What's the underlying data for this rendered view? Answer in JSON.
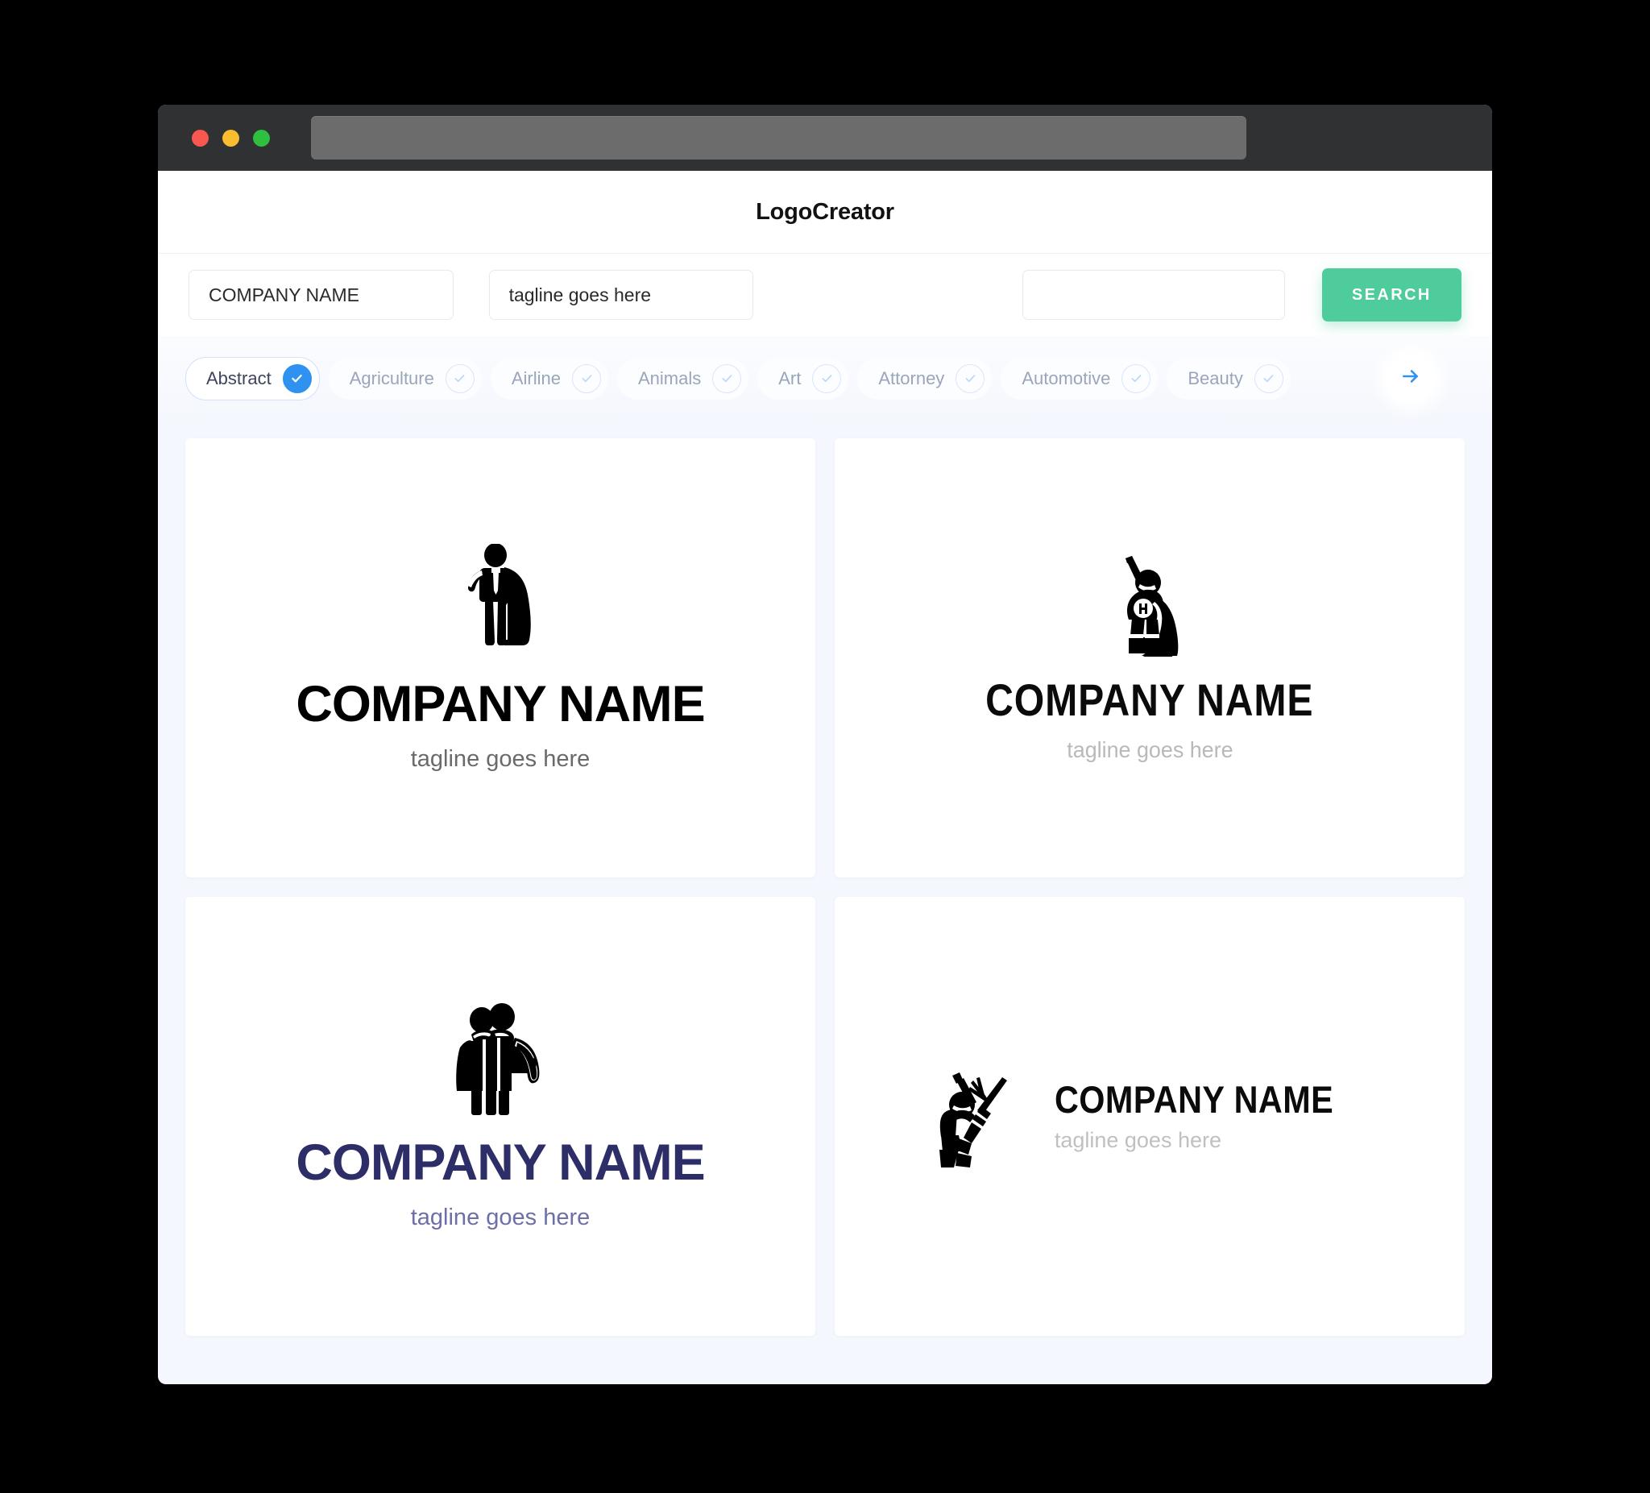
{
  "window": {
    "traffic_lights": [
      "close",
      "minimize",
      "maximize"
    ],
    "url_value": ""
  },
  "header": {
    "app_title": "LogoCreator"
  },
  "search": {
    "company_value": "COMPANY NAME",
    "company_placeholder": "COMPANY NAME",
    "tagline_value": "tagline goes here",
    "tagline_placeholder": "tagline goes here",
    "keyword_value": "",
    "keyword_placeholder": "",
    "search_label": "SEARCH"
  },
  "categories": {
    "next_icon": "arrow-right-icon",
    "items": [
      {
        "label": "Abstract",
        "selected": true,
        "icon": "check-icon"
      },
      {
        "label": "Agriculture",
        "selected": false,
        "icon": "check-icon"
      },
      {
        "label": "Airline",
        "selected": false,
        "icon": "check-icon"
      },
      {
        "label": "Animals",
        "selected": false,
        "icon": "check-icon"
      },
      {
        "label": "Art",
        "selected": false,
        "icon": "check-icon"
      },
      {
        "label": "Attorney",
        "selected": false,
        "icon": "check-icon"
      },
      {
        "label": "Automotive",
        "selected": false,
        "icon": "check-icon"
      },
      {
        "label": "Beauty",
        "selected": false,
        "icon": "check-icon"
      }
    ]
  },
  "results": [
    {
      "icon": "superhero-businessman-cape-icon",
      "company_name": "COMPANY NAME",
      "tagline": "tagline goes here",
      "text_color": "#000000",
      "tagline_color": "#6a6a6a",
      "layout": "stacked"
    },
    {
      "icon": "superhero-raised-arm-h-badge-icon",
      "company_name": "COMPANY NAME",
      "tagline": "tagline goes here",
      "text_color": "#0b0b0b",
      "tagline_color": "#b9b9b9",
      "layout": "stacked"
    },
    {
      "icon": "two-heroes-couple-cape-icon",
      "company_name": "COMPANY NAME",
      "tagline": "tagline goes here",
      "text_color": "#2d2e68",
      "tagline_color": "#6d6fa6",
      "layout": "stacked"
    },
    {
      "icon": "hero-with-sword-icon",
      "company_name": "COMPANY NAME",
      "tagline": "tagline goes here",
      "text_color": "#0b0b0b",
      "tagline_color": "#c0c0c0",
      "layout": "horizontal"
    }
  ],
  "colors": {
    "accent_green": "#4fcc9b",
    "accent_blue": "#2f91f0",
    "page_background": "#f4f7fd",
    "titlebar": "#2f3133",
    "navy": "#2d2e68"
  }
}
